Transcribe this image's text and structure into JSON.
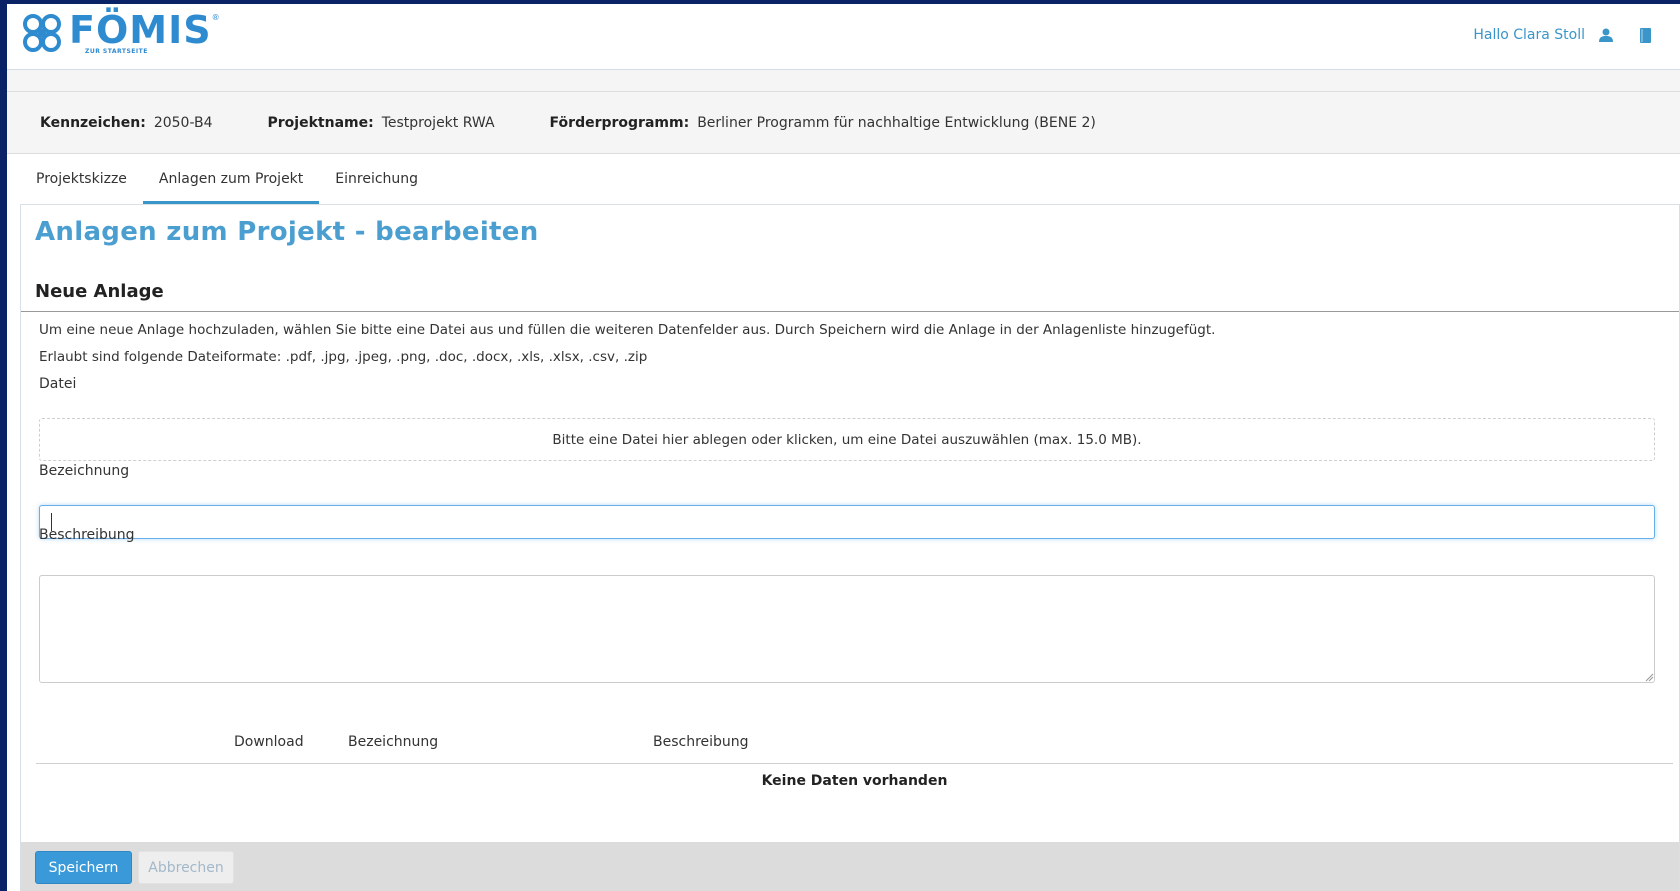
{
  "header": {
    "logo": {
      "name": "FÖMIS",
      "registered": "®",
      "subtitle": "ZUR STARTSEITE"
    },
    "greeting": "Hallo Clara Stoll",
    "icons": {
      "user": "user-icon",
      "manual": "book-icon"
    },
    "accent_color": "#3a96c9"
  },
  "project_info": {
    "kennzeichen": {
      "label": "Kennzeichen:",
      "value": "2050-B4"
    },
    "projektname": {
      "label": "Projektname:",
      "value": "Testprojekt RWA"
    },
    "foerderprogramm": {
      "label": "Förderprogramm:",
      "value": "Berliner Programm für nachhaltige Entwicklung (BENE 2)"
    }
  },
  "tabs": [
    {
      "label": "Projektskizze",
      "active": false
    },
    {
      "label": "Anlagen zum Projekt",
      "active": true
    },
    {
      "label": "Einreichung",
      "active": false
    }
  ],
  "main": {
    "title": "Anlagen zum Projekt - bearbeiten",
    "section_title": "Neue Anlage",
    "intro": "Um eine neue Anlage hochzuladen, wählen Sie bitte eine Datei aus und füllen die weiteren Datenfelder aus. Durch Speichern wird die Anlage in der Anlagenliste hinzugefügt.",
    "formats": "Erlaubt sind folgende Dateiformate: .pdf, .jpg, .jpeg, .png, .doc, .docx, .xls, .xlsx, .csv, .zip",
    "file_label": "Datei",
    "dropzone_text": "Bitte eine Datei hier ablegen oder klicken, um eine Datei auszuwählen (max. 15.0 MB).",
    "bezeichnung_label": "Bezeichnung",
    "bezeichnung_value": "",
    "beschreibung_label": "Beschreibung",
    "beschreibung_value": ""
  },
  "attachments_table": {
    "columns": [
      "Download",
      "Bezeichnung",
      "Beschreibung"
    ],
    "rows": [],
    "empty_text": "Keine Daten vorhanden"
  },
  "footer": {
    "save_label": "Speichern",
    "cancel_label": "Abbrechen"
  }
}
